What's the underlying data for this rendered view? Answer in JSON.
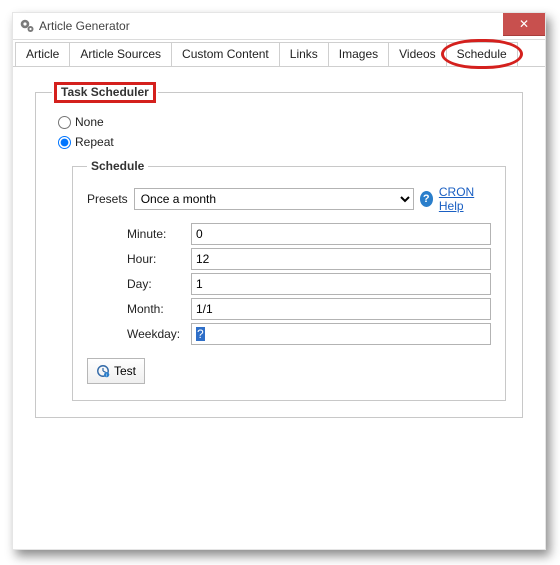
{
  "window": {
    "title": "Article Generator",
    "close_glyph": "✕"
  },
  "tabs": {
    "article": "Article",
    "article_sources": "Article Sources",
    "custom_content": "Custom Content",
    "links": "Links",
    "images": "Images",
    "videos": "Videos",
    "schedule": "Schedule"
  },
  "task_scheduler": {
    "legend": "Task Scheduler",
    "none_label": "None",
    "repeat_label": "Repeat"
  },
  "schedule": {
    "legend": "Schedule",
    "presets_label": "Presets",
    "preset_value": "Once a month",
    "cron_help": "CRON Help",
    "fields": {
      "minute": {
        "label": "Minute:",
        "value": "0"
      },
      "hour": {
        "label": "Hour:",
        "value": "12"
      },
      "day": {
        "label": "Day:",
        "value": "1"
      },
      "month": {
        "label": "Month:",
        "value": "1/1"
      },
      "weekday": {
        "label": "Weekday:",
        "value": "?"
      }
    },
    "test_label": "Test"
  }
}
